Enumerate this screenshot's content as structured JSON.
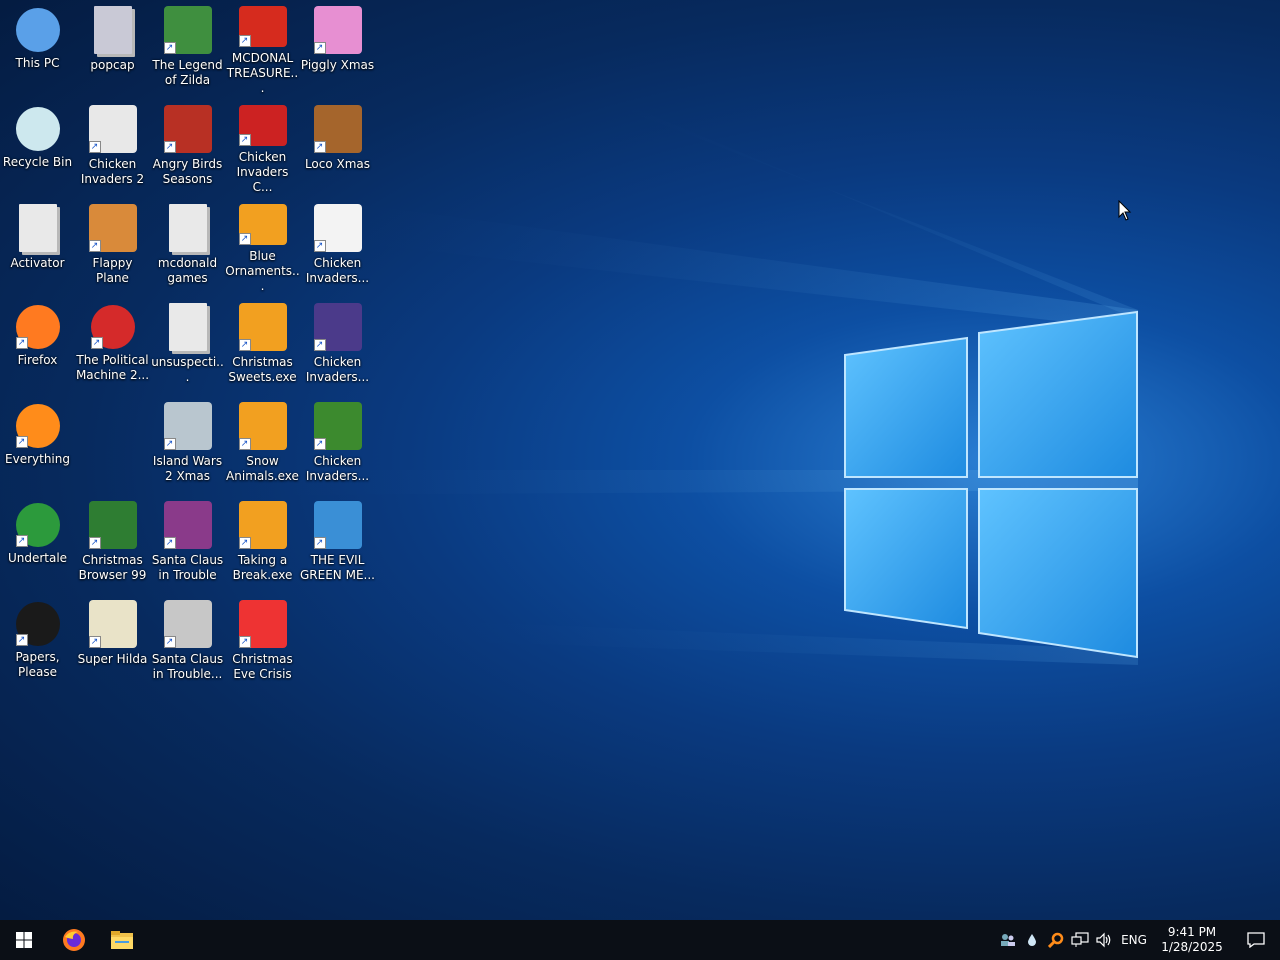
{
  "desktop": {
    "icons": [
      {
        "label": "This PC",
        "icon": "computer-icon",
        "color": "#5aa0e8"
      },
      {
        "label": "popcap",
        "icon": "folder-icon",
        "color": "#c9c9d6"
      },
      {
        "label": "The Legend of Zilda",
        "icon": "game-icon",
        "color": "#3f8f3f"
      },
      {
        "label": "MCDONAL TREASURE...",
        "icon": "mcdonalds-icon",
        "color": "#d62b1e"
      },
      {
        "label": "Piggly Xmas",
        "icon": "pig-icon",
        "color": "#e78fd2"
      },
      {
        "label": "Recycle Bin",
        "icon": "recycle-bin-icon",
        "color": "#cde8ee"
      },
      {
        "label": "Chicken Invaders 2",
        "icon": "chicken-icon",
        "color": "#e8e8e8"
      },
      {
        "label": "Angry Birds Seasons",
        "icon": "angry-birds-icon",
        "color": "#b83024"
      },
      {
        "label": "Chicken Invaders C...",
        "icon": "snowman-icon",
        "color": "#c22"
      },
      {
        "label": "Loco Xmas",
        "icon": "bear-icon",
        "color": "#a5652c"
      },
      {
        "label": "Activator",
        "icon": "file-icon",
        "color": "#e9e9e9"
      },
      {
        "label": "Flappy Plane",
        "icon": "game-icon",
        "color": "#d98a3a"
      },
      {
        "label": "mcdonald games",
        "icon": "file-icon",
        "color": "#e9e9e9"
      },
      {
        "label": "Blue Ornaments...",
        "icon": "app-icon",
        "color": "#f2a020"
      },
      {
        "label": "Chicken Invaders...",
        "icon": "chicken-icon",
        "color": "#f3f3f3"
      },
      {
        "label": "Firefox",
        "icon": "firefox-icon",
        "color": "#ff7a20"
      },
      {
        "label": "The Political Machine 2...",
        "icon": "political-icon",
        "color": "#d52a2a"
      },
      {
        "label": "unsuspecti...",
        "icon": "file-icon",
        "color": "#e9e9e9"
      },
      {
        "label": "Christmas Sweets.exe",
        "icon": "app-icon",
        "color": "#f2a020"
      },
      {
        "label": "Chicken Invaders...",
        "icon": "chicken-icon",
        "color": "#4b3a8a"
      },
      {
        "label": "Everything",
        "icon": "search-icon",
        "color": "#ff8c1a"
      },
      {
        "label": "",
        "icon": "",
        "color": ""
      },
      {
        "label": "Island Wars 2 Xmas",
        "icon": "island-icon",
        "color": "#b9c6cf"
      },
      {
        "label": "Snow Animals.exe",
        "icon": "app-icon",
        "color": "#f2a020"
      },
      {
        "label": "Chicken Invaders...",
        "icon": "chicken-icon",
        "color": "#3c8a2e"
      },
      {
        "label": "Undertale",
        "icon": "undertale-icon",
        "color": "#2c9a3c"
      },
      {
        "label": "Christmas Browser 99",
        "icon": "tree-icon",
        "color": "#2e7d32"
      },
      {
        "label": "Santa Claus in Trouble",
        "icon": "santa-icon",
        "color": "#8a3a8a"
      },
      {
        "label": "Taking a Break.exe",
        "icon": "app-icon",
        "color": "#f2a020"
      },
      {
        "label": "THE EVIL GREEN ME...",
        "icon": "messenger-icon",
        "color": "#3a8fd6"
      },
      {
        "label": "Papers, Please",
        "icon": "papers-please-icon",
        "color": "#1a1a1a"
      },
      {
        "label": "Super Hilda",
        "icon": "game-icon",
        "color": "#e9e3c8"
      },
      {
        "label": "Santa Claus in Trouble...",
        "icon": "santa-icon",
        "color": "#c7c7c7"
      },
      {
        "label": "Christmas Eve Crisis",
        "icon": "santa-icon",
        "color": "#e33"
      }
    ]
  },
  "taskbar": {
    "start_icon": "windows-logo-icon",
    "pinned": [
      {
        "icon": "firefox-icon"
      },
      {
        "icon": "file-explorer-icon"
      }
    ],
    "tray": {
      "language": "ENG",
      "time": "9:41 PM",
      "date": "1/28/2025"
    }
  },
  "colors": {
    "taskbar_bg": "#0b0f16",
    "wallpaper_glow": "#2a7fd4"
  }
}
